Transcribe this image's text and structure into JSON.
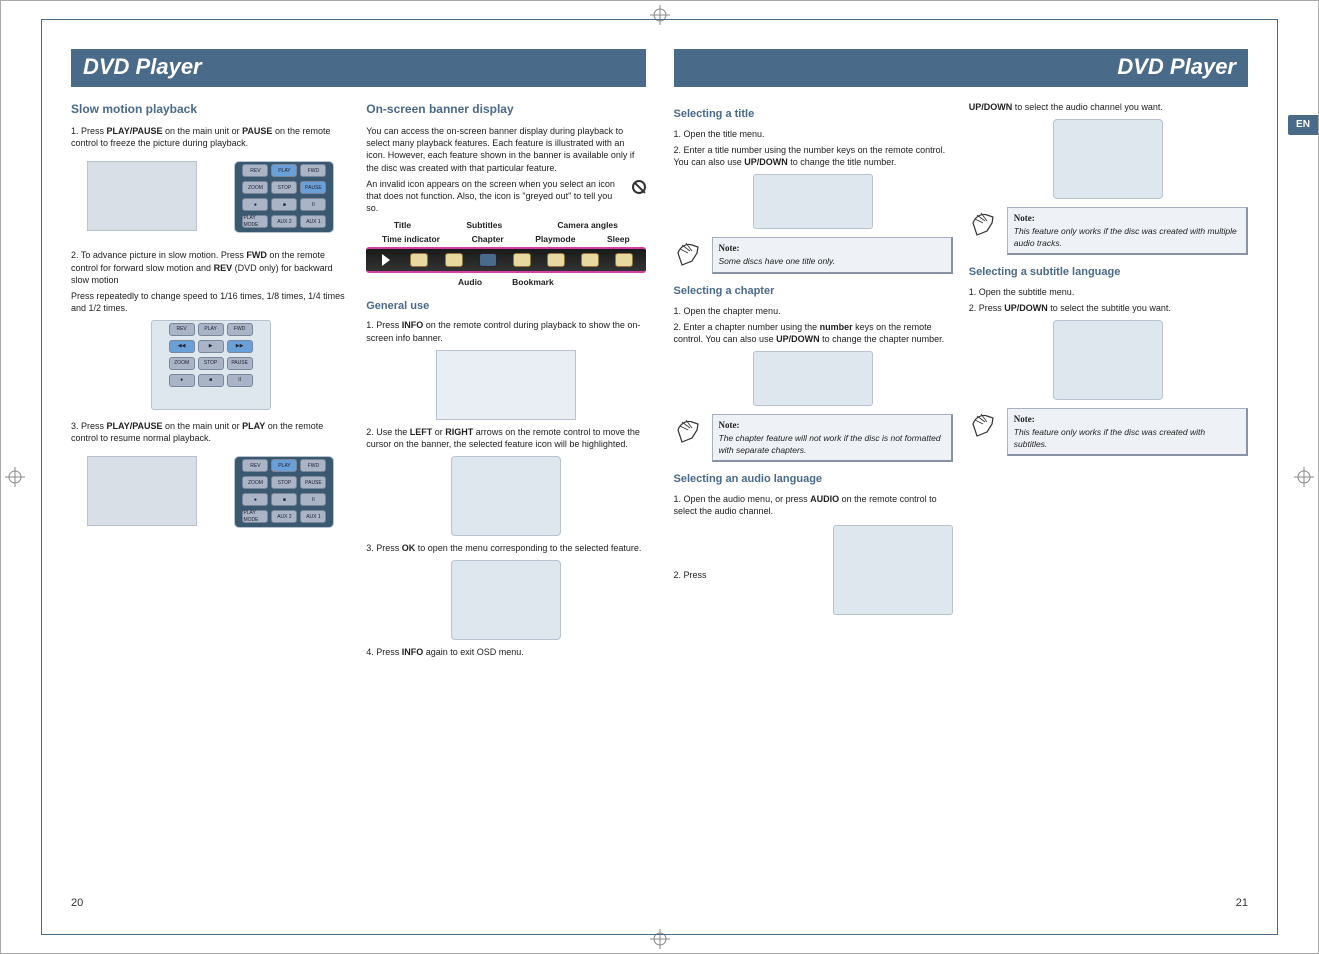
{
  "language_tab": "EN",
  "left_page": {
    "header": "DVD Player",
    "page_number": "20",
    "col1": {
      "sec1": {
        "title": "Slow motion playback",
        "p1_a": "1. Press ",
        "p1_b": "PLAY/PAUSE",
        "p1_c": " on the main unit or ",
        "p1_d": "PAUSE",
        "p1_e": " on the remote control to freeze the picture during playback.",
        "p2_a": "2. To advance picture in slow motion. Press ",
        "p2_b": "FWD",
        "p2_c": " on the remote control for forward slow motion and ",
        "p2_d": "REV",
        "p2_e": " (DVD only) for backward slow motion",
        "p3": "Press repeatedly to change speed to 1/16 times, 1/8 times, 1/4 times and 1/2 times.",
        "p4_a": "3. Press ",
        "p4_b": "PLAY/PAUSE",
        "p4_c": " on the main unit or ",
        "p4_d": "PLAY",
        "p4_e": " on the remote control to resume normal playback."
      }
    },
    "col2": {
      "sec1": {
        "title": "On-screen banner display",
        "p1": "You can access the on-screen banner display during playback to select many playback features. Each feature is illustrated with an icon. However, each feature shown in the banner is available only if the disc was created with that particular feature.",
        "p2": "An invalid icon appears on the screen when you select an icon that does not function. Also, the icon is \"greyed out\" to tell you so.",
        "labels": {
          "time": "Time indicator",
          "title": "Title",
          "chapter": "Chapter",
          "subtitles": "Subtitles",
          "playmode": "Playmode",
          "camera": "Camera angles",
          "sleep": "Sleep",
          "audio": "Audio",
          "bookmark": "Bookmark"
        }
      },
      "sec2": {
        "title": "General use",
        "p1_a": "1. Press ",
        "p1_b": "INFO",
        "p1_c": " on the remote control during playback to show the on-screen info banner.",
        "p2_a": "2. Use the ",
        "p2_b": "LEFT",
        "p2_c": " or ",
        "p2_d": "RIGHT",
        "p2_e": " arrows on the remote control to move the cursor on the banner, the selected feature icon will be highlighted.",
        "p3_a": "3. Press ",
        "p3_b": "OK",
        "p3_c": " to open the menu corresponding to the selected feature.",
        "p4_a": "4. Press ",
        "p4_b": "INFO",
        "p4_c": " again to exit OSD menu."
      }
    }
  },
  "right_page": {
    "header": "DVD Player",
    "page_number": "21",
    "col1": {
      "sec1": {
        "title": "Selecting a title",
        "p1": "1. Open the title menu.",
        "p2_a": "2. Enter a title number using the number keys on the remote control. You can also use ",
        "p2_b": "UP/DOWN",
        "p2_c": " to change the title number.",
        "note_label": "Note:",
        "note_text": "Some discs have one title only."
      },
      "sec2": {
        "title": "Selecting a chapter",
        "p1": "1. Open the chapter menu.",
        "p2_a": "2. Enter a chapter number using the ",
        "p2_b": "number",
        "p2_c": " keys on the remote control. You can also use ",
        "p2_d": "UP/DOWN",
        "p2_e": " to change the chapter number.",
        "note_label": "Note:",
        "note_text": "The chapter feature will not work if the disc is not formatted with separate chapters."
      },
      "sec3": {
        "title": "Selecting an audio language",
        "p1_a": "1. Open the audio menu, or press ",
        "p1_b": "AUDIO",
        "p1_c": " on the remote control to select the audio channel.",
        "p2": "2. Press"
      }
    },
    "col2": {
      "top_a": "UP/DOWN",
      "top_b": " to select the audio channel you want.",
      "note1_label": "Note:",
      "note1_text": "This feature only works if the disc was created with multiple audio tracks.",
      "sec1": {
        "title": "Selecting a subtitle language",
        "p1": "1. Open the subtitle menu.",
        "p2_a": "2. Press ",
        "p2_b": "UP/DOWN",
        "p2_c": " to select the subtitle you want.",
        "note_label": "Note:",
        "note_text": "This feature only works if the disc was created with subtitles."
      }
    }
  }
}
